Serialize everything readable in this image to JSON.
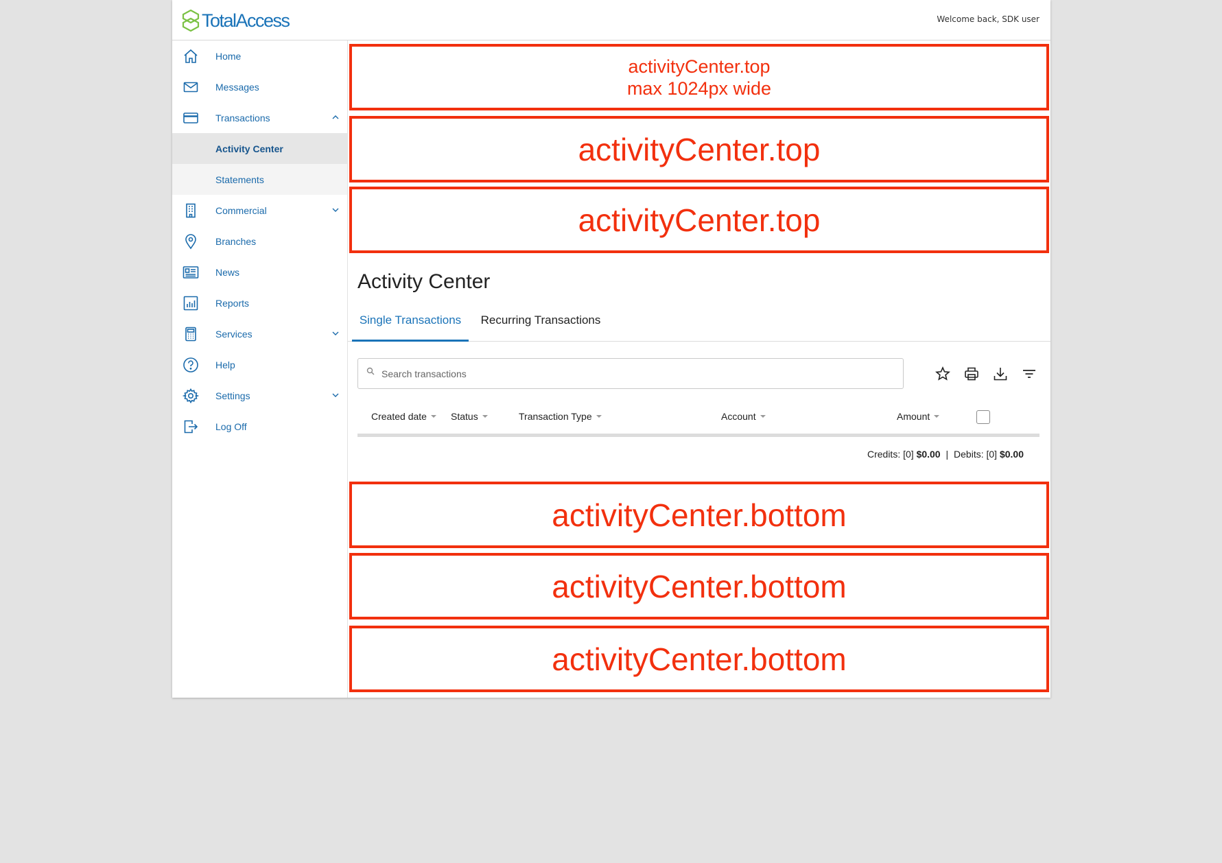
{
  "app": {
    "brand": "TotalAccess",
    "welcome": "Welcome back, SDK user"
  },
  "sidebar": {
    "items": [
      {
        "label": "Home",
        "icon": "home-icon"
      },
      {
        "label": "Messages",
        "icon": "mail-icon"
      },
      {
        "label": "Transactions",
        "icon": "card-icon",
        "expanded": true
      },
      {
        "label": "Activity Center",
        "sub": true,
        "active": true
      },
      {
        "label": "Statements",
        "sub": true
      },
      {
        "label": "Commercial",
        "icon": "building-icon",
        "expandable": true
      },
      {
        "label": "Branches",
        "icon": "location-pin-icon"
      },
      {
        "label": "News",
        "icon": "newspaper-icon"
      },
      {
        "label": "Reports",
        "icon": "bar-chart-icon"
      },
      {
        "label": "Services",
        "icon": "calculator-icon",
        "expandable": true
      },
      {
        "label": "Help",
        "icon": "help-icon"
      },
      {
        "label": "Settings",
        "icon": "gear-icon",
        "expandable": true
      },
      {
        "label": "Log Off",
        "icon": "logout-icon"
      }
    ]
  },
  "slots": {
    "top1_line1": "activityCenter.top",
    "top1_line2": "max 1024px wide",
    "top2": "activityCenter.top",
    "top3": "activityCenter.top",
    "bottom1": "activityCenter.bottom",
    "bottom2": "activityCenter.bottom",
    "bottom3": "activityCenter.bottom"
  },
  "main": {
    "title": "Activity Center",
    "tabs": [
      {
        "label": "Single Transactions",
        "active": true
      },
      {
        "label": "Recurring Transactions",
        "active": false
      }
    ],
    "search": {
      "placeholder": "Search transactions",
      "value": ""
    },
    "toolbar": [
      "star-icon",
      "print-icon",
      "download-icon",
      "filter-icon"
    ],
    "columns": [
      "Created date",
      "Status",
      "Transaction Type",
      "Account",
      "Amount"
    ],
    "totals": {
      "credits_label": "Credits: [0]",
      "credits_value": "$0.00",
      "separator": "|",
      "debits_label": "Debits: [0]",
      "debits_value": "$0.00"
    }
  },
  "colors": {
    "brand_blue": "#1a73b8",
    "brand_green": "#7ac143",
    "slot_red": "#f2300e"
  }
}
